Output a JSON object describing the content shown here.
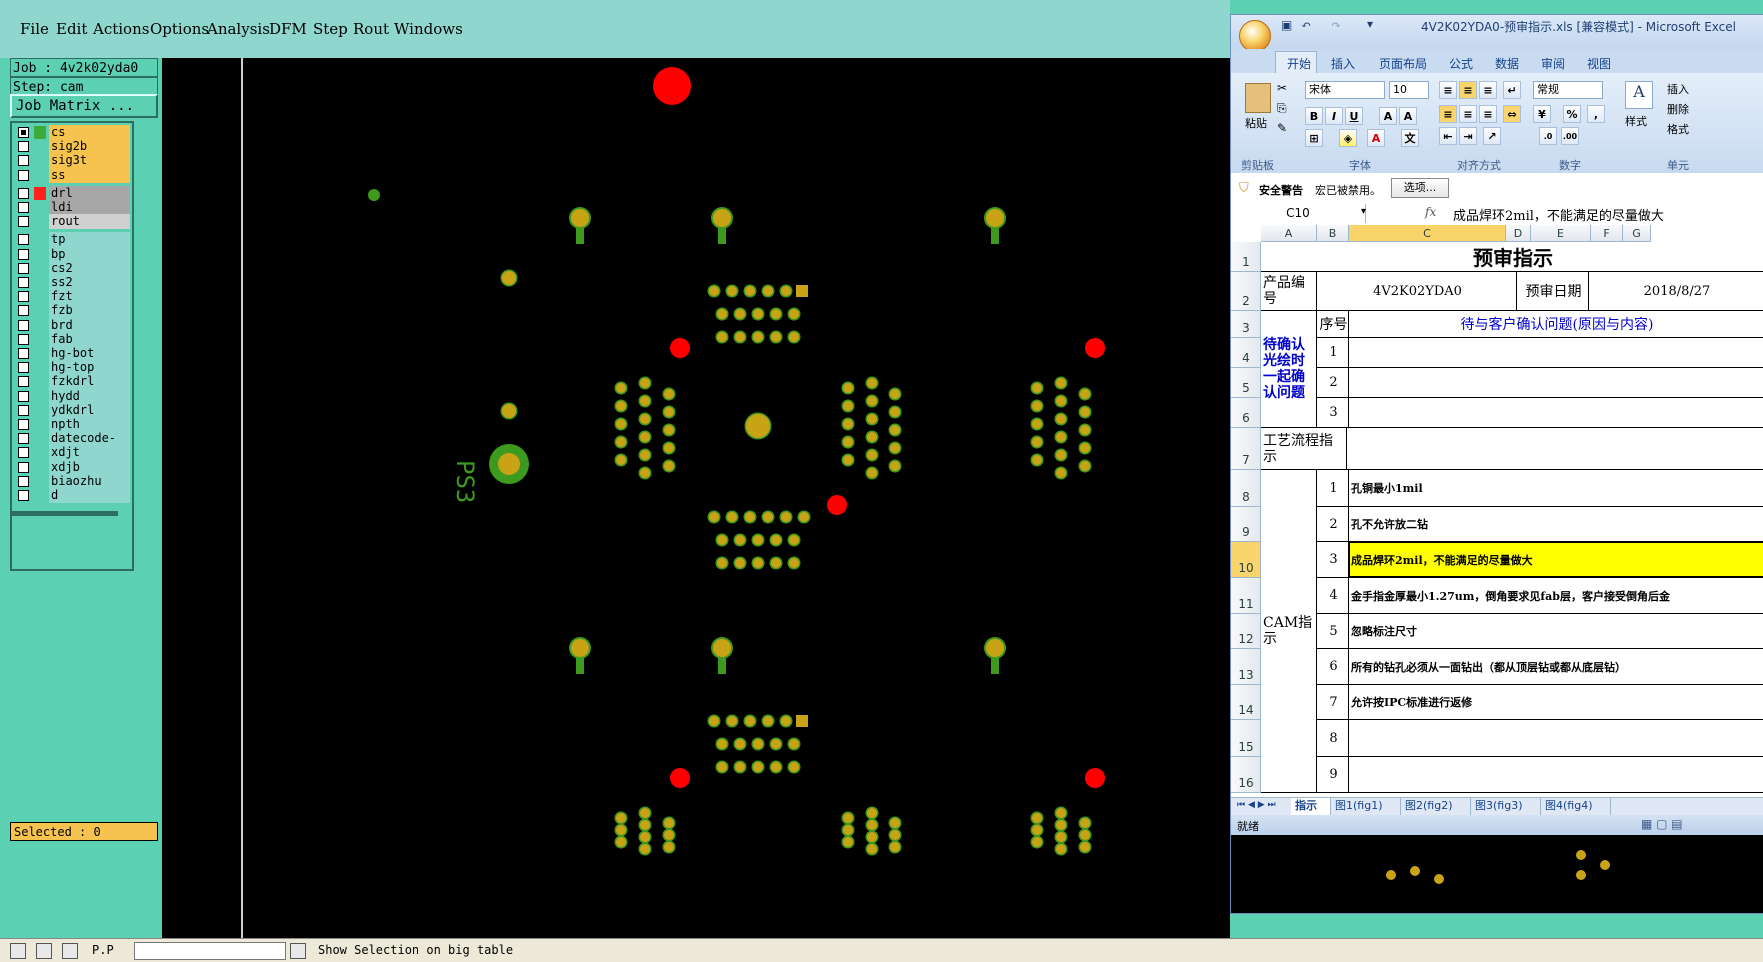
{
  "cam": {
    "menu": [
      "File",
      "Edit",
      "Actions",
      "Options",
      "Analysis",
      "DFM",
      "Step",
      "Rout",
      "Windows"
    ],
    "job_label": "Job : 4v2k02yda0",
    "step_label": "Step: cam",
    "job_matrix": "Job Matrix ...",
    "layers_board": [
      {
        "name": "cs",
        "color": "#f6c44e",
        "swatch": "#3cab3c",
        "checked": true
      },
      {
        "name": "sig2b",
        "color": "#f6c44e",
        "swatch": "",
        "checked": false
      },
      {
        "name": "sig3t",
        "color": "#f6c44e",
        "swatch": "",
        "checked": false
      },
      {
        "name": "ss",
        "color": "#f6c44e",
        "swatch": "",
        "checked": false
      }
    ],
    "layers_drill": [
      {
        "name": "drl",
        "color": "#a7a7a7",
        "swatch": "#ff2020",
        "checked": false
      },
      {
        "name": "ldi",
        "color": "#a7a7a7",
        "swatch": "",
        "checked": false
      },
      {
        "name": "rout",
        "color": "#d0d0d0",
        "swatch": "",
        "checked": false
      }
    ],
    "layers_misc": [
      "tp",
      "bp",
      "cs2",
      "ss2",
      "fzt",
      "fzb",
      "brd",
      "fab",
      "hg-bot",
      "hg-top",
      "fzkdrl",
      "hydd",
      "ydkdrl",
      "npth",
      "datecode-cs",
      "xdjt",
      "xdjb",
      "biaozhu",
      "d"
    ],
    "selected": "Selected : 0",
    "silk_label": "PS3",
    "bottom_bar_left": "P.P",
    "bottom_status": "Show Selection on big table",
    "colors": {
      "pad": "#c8a316",
      "trace": "#3d9a1e",
      "drill": "#ff0000",
      "canvas": "#000000"
    }
  },
  "excel": {
    "title": "4V2K02YDA0-预审指示.xls [兼容模式] - Microsoft Excel",
    "tabs": [
      "开始",
      "插入",
      "页面布局",
      "公式",
      "数据",
      "审阅",
      "视图"
    ],
    "font_name": "宋体",
    "font_size": "10",
    "number_format": "常规",
    "group_labels": [
      "剪贴板",
      "字体",
      "对齐方式",
      "数字",
      "单元"
    ],
    "paste_label": "粘贴",
    "style_label": "样式",
    "right_btns": [
      "插入",
      "删除",
      "格式"
    ],
    "security_title": "安全警告",
    "security_msg": "宏已被禁用。",
    "security_btn": "选项...",
    "name_box": "C10",
    "formula_fx": "fx",
    "formula_value": "成品焊环2mil，不能满足的尽量做大",
    "columns": [
      "A",
      "B",
      "C",
      "D",
      "E",
      "F",
      "G"
    ],
    "sheet": {
      "title": "预审指示",
      "product_label": "产品编号",
      "product_value": "4V2K02YDA0",
      "date_label": "预审日期",
      "date_value": "2018/8/27",
      "seq_header": "序号",
      "issue_header": "待与客户确认问题(原因与内容)",
      "confirm_label": "待确认光绘时一起确认问题",
      "confirm_rows": [
        "1",
        "2",
        "3"
      ],
      "process_label": "工艺流程指示",
      "cam_label": "CAM指示",
      "cam_items": [
        {
          "no": "1",
          "text": "孔铜最小1mil"
        },
        {
          "no": "2",
          "text": "孔不允许放二钻"
        },
        {
          "no": "3",
          "text": "成品焊环2mil，不能满足的尽量做大"
        },
        {
          "no": "4",
          "text": "金手指金厚最小1.27um，倒角要求见fab层，客户接受倒角后金"
        },
        {
          "no": "5",
          "text": "忽略标注尺寸"
        },
        {
          "no": "6",
          "text": "所有的钻孔必须从一面钻出（都从顶层钻或都从底层钻）"
        },
        {
          "no": "7",
          "text": "允许按IPC标准进行返修"
        },
        {
          "no": "8",
          "text": ""
        },
        {
          "no": "9",
          "text": ""
        }
      ],
      "row_numbers": [
        "1",
        "2",
        "3",
        "4",
        "5",
        "6",
        "7",
        "8",
        "9",
        "10",
        "11",
        "12",
        "13",
        "14",
        "15",
        "16"
      ]
    },
    "sheet_tabs": [
      "指示",
      "图1(fig1)",
      "图2(fig2)",
      "图3(fig3)",
      "图4(fig4)"
    ],
    "status": "就绪",
    "highlight_color": "#ffff00",
    "blue_text": "#0000cc"
  }
}
